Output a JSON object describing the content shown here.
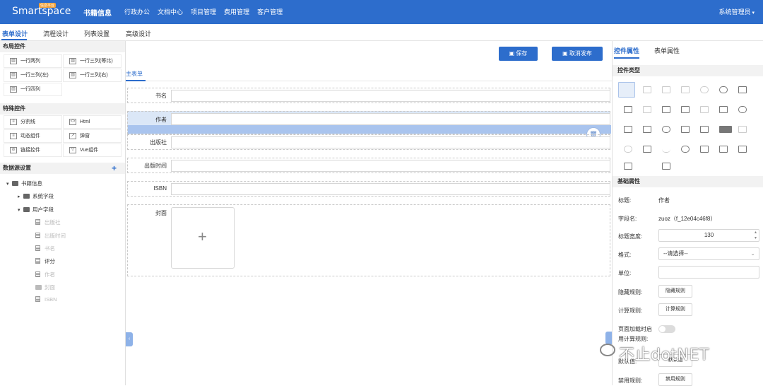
{
  "topbar": {
    "logo": "Smartspace",
    "logo_badge": "信息平台",
    "app_title": "书籍信息",
    "nav": [
      "行政办公",
      "文档中心",
      "项目管理",
      "费用管理",
      "客户管理"
    ],
    "user": "系统管理员"
  },
  "tabs": [
    "表单设计",
    "流程设计",
    "列表设置",
    "高级设计"
  ],
  "left": {
    "layout_title": "布局控件",
    "layout_items": [
      "一行两列",
      "一行三列(等比)",
      "一行三列(左)",
      "一行三列(右)",
      "一行四列"
    ],
    "special_title": "特殊控件",
    "special_items": [
      "分割线",
      "Html",
      "动态组件",
      "弹窗",
      "链接控件",
      "Vue组件"
    ],
    "datasource_title": "数据源设置",
    "tree": {
      "root": "书籍信息",
      "sys": "系统字段",
      "user": "用户字段",
      "fields": [
        "出版社",
        "出版时间",
        "书名",
        "评分",
        "作者",
        "封面",
        "ISBN"
      ]
    }
  },
  "center": {
    "save_label": "保存",
    "cancel_label": "取消发布",
    "main_tab": "主表单",
    "fields": [
      "书名",
      "作者",
      "出版社",
      "出版时间",
      "ISBN",
      "封面"
    ]
  },
  "right": {
    "tabs": [
      "控件属性",
      "表单属性"
    ],
    "type_title": "控件类型",
    "basic_title": "基础属性",
    "props": {
      "title_label": "标题:",
      "title_value": "作者",
      "field_label": "字段名:",
      "field_value": "zuoz（f_12e04c46f8）",
      "width_label": "标题宽度:",
      "width_value": "130",
      "format_label": "格式:",
      "format_value": "--请选择--",
      "unit_label": "单位:",
      "hide_label": "隐藏规则:",
      "hide_btn": "隐藏规则",
      "calc_label": "计算规则:",
      "calc_btn": "计算规则",
      "onload_label": "页面加载时启",
      "calc_rule_label": "用计算规则:",
      "default_label": "默认值:",
      "default_btn": "默认值",
      "disable_label": "禁用规则:",
      "disable_btn": "禁用规则"
    }
  },
  "watermark": "不止dotNET"
}
